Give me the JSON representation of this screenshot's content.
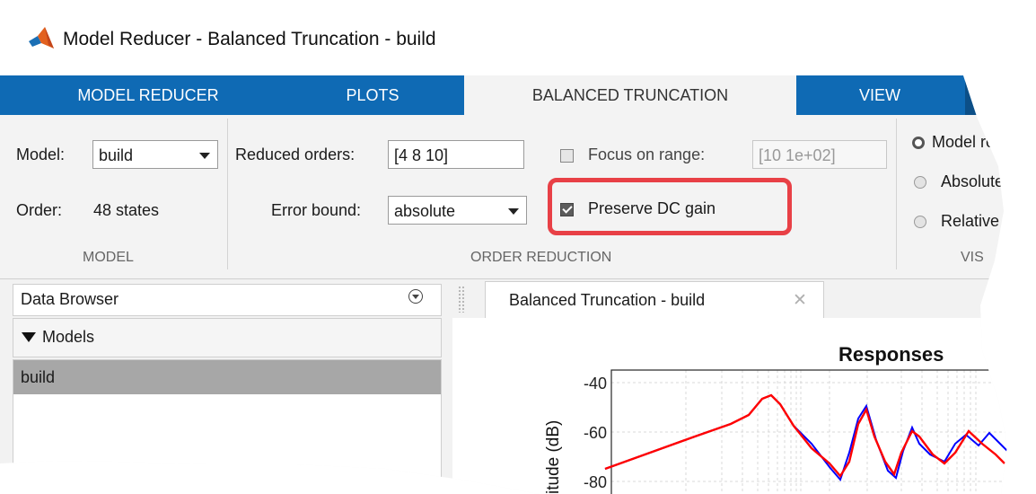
{
  "window": {
    "title": "Model Reducer - Balanced Truncation - build"
  },
  "tabs": [
    {
      "label": "MODEL REDUCER",
      "active": false
    },
    {
      "label": "PLOTS",
      "active": false
    },
    {
      "label": "BALANCED TRUNCATION",
      "active": true
    },
    {
      "label": "VIEW",
      "active": false
    }
  ],
  "model_section": {
    "model_label": "Model:",
    "model_value": "build",
    "order_label": "Order:",
    "order_value": "48 states",
    "section_label": "MODEL"
  },
  "order_reduction": {
    "reduced_orders_label": "Reduced orders:",
    "reduced_orders_value": "[4 8 10]",
    "error_bound_label": "Error bound:",
    "error_bound_value": "absolute",
    "focus_label": "Focus on range:",
    "focus_checked": false,
    "focus_range_value": "[10 1e+02]",
    "preserve_dc_label": "Preserve DC gain",
    "preserve_dc_checked": true,
    "section_label": "ORDER REDUCTION"
  },
  "visualize": {
    "options": [
      {
        "label": "Model res",
        "selected": true
      },
      {
        "label": "Absolute",
        "selected": false
      },
      {
        "label": "Relative",
        "selected": false
      }
    ],
    "section_label": "VIS"
  },
  "data_browser": {
    "title": "Data Browser",
    "group_label": "Models",
    "items": [
      "build"
    ]
  },
  "document_tab": {
    "label": "Balanced Truncation - build"
  },
  "chart_data": {
    "type": "line",
    "title": "Responses",
    "ylabel": "itude (dB)",
    "y_ticks": [
      "-40",
      "-60",
      "-80"
    ],
    "series": [
      {
        "color": "#0000ff"
      },
      {
        "color": "#ff0000"
      }
    ]
  },
  "colors": {
    "tab_bar": "#0f6ab4",
    "highlight": "#e84046"
  }
}
